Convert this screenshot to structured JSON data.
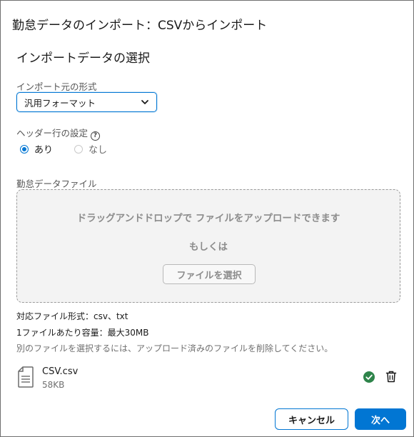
{
  "dialog": {
    "title": "勤怠データのインポート：CSVからインポート",
    "section_title": "インポートデータの選択"
  },
  "format": {
    "label": "インポート元の形式",
    "selected": "汎用フォーマット",
    "chevron_icon": "chevron-down-icon"
  },
  "header_setting": {
    "label": "ヘッダー行の設定",
    "help_icon": "help-icon",
    "options": [
      {
        "label": "あり",
        "selected": true
      },
      {
        "label": "なし",
        "selected": false
      }
    ]
  },
  "file_upload": {
    "label": "勤怠データファイル",
    "drop_text": "ドラッグアンドドロップで ファイルをアップロードできます",
    "or_text": "もしくは",
    "select_button": "ファイルを選択"
  },
  "info": {
    "formats": "対応ファイル形式：csv、txt",
    "capacity": "1ファイルあたり容量：最大30MB",
    "note": "別のファイルを選択するには、アップロード済みのファイルを削除してください。"
  },
  "uploaded_file": {
    "name": "CSV.csv",
    "size": "58KB",
    "status_icon": "check-circle-icon",
    "delete_icon": "trash-icon"
  },
  "actions": {
    "cancel": "キャンセル",
    "next": "次へ"
  },
  "colors": {
    "accent": "#0176d3",
    "success": "#2e844a"
  }
}
